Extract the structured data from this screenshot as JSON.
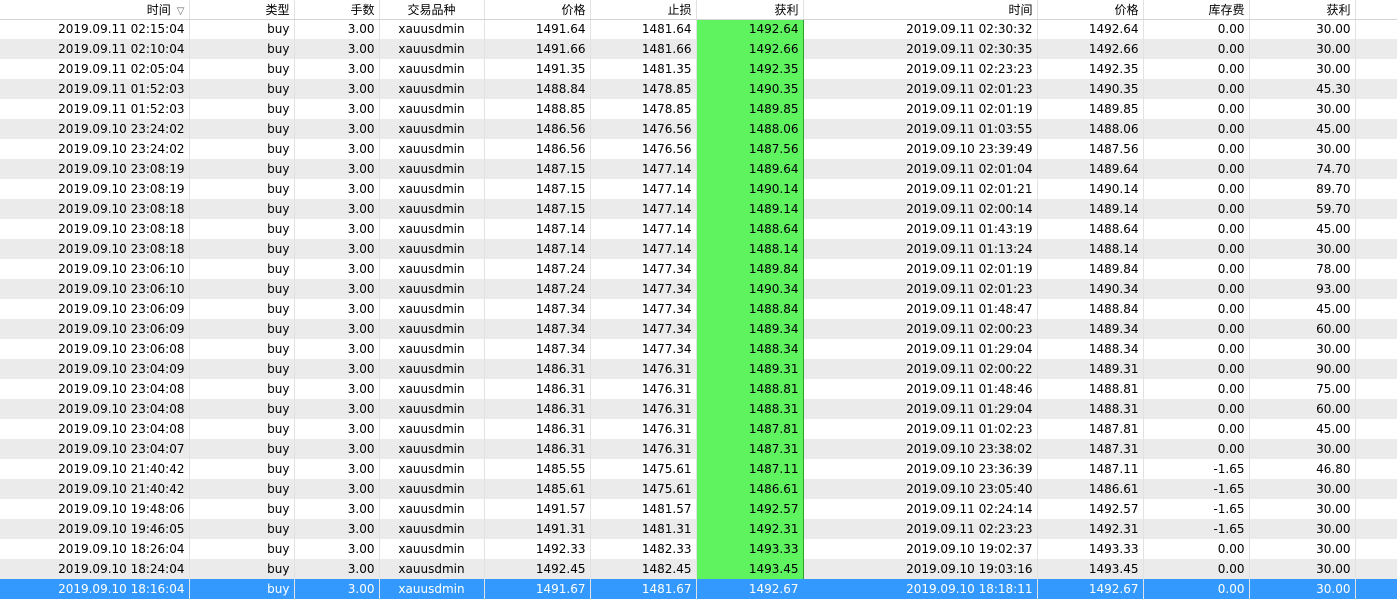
{
  "headers": {
    "open_time": "时间",
    "sort_icon": "▽",
    "type": "类型",
    "lots": "手数",
    "symbol": "交易品种",
    "price": "价格",
    "sl": "止损",
    "tp": "获利",
    "empty": "",
    "close_time": "时间",
    "close_price": "价格",
    "swap": "库存费",
    "profit": "获利"
  },
  "rows": [
    [
      "2019.09.11 02:15:04",
      "buy",
      "3.00",
      "xauusdmin",
      "1491.64",
      "1481.64",
      "1492.64",
      "2019.09.11 02:30:32",
      "1492.64",
      "0.00",
      "30.00"
    ],
    [
      "2019.09.11 02:10:04",
      "buy",
      "3.00",
      "xauusdmin",
      "1491.66",
      "1481.66",
      "1492.66",
      "2019.09.11 02:30:35",
      "1492.66",
      "0.00",
      "30.00"
    ],
    [
      "2019.09.11 02:05:04",
      "buy",
      "3.00",
      "xauusdmin",
      "1491.35",
      "1481.35",
      "1492.35",
      "2019.09.11 02:23:23",
      "1492.35",
      "0.00",
      "30.00"
    ],
    [
      "2019.09.11 01:52:03",
      "buy",
      "3.00",
      "xauusdmin",
      "1488.84",
      "1478.85",
      "1490.35",
      "2019.09.11 02:01:23",
      "1490.35",
      "0.00",
      "45.30"
    ],
    [
      "2019.09.11 01:52:03",
      "buy",
      "3.00",
      "xauusdmin",
      "1488.85",
      "1478.85",
      "1489.85",
      "2019.09.11 02:01:19",
      "1489.85",
      "0.00",
      "30.00"
    ],
    [
      "2019.09.10 23:24:02",
      "buy",
      "3.00",
      "xauusdmin",
      "1486.56",
      "1476.56",
      "1488.06",
      "2019.09.11 01:03:55",
      "1488.06",
      "0.00",
      "45.00"
    ],
    [
      "2019.09.10 23:24:02",
      "buy",
      "3.00",
      "xauusdmin",
      "1486.56",
      "1476.56",
      "1487.56",
      "2019.09.10 23:39:49",
      "1487.56",
      "0.00",
      "30.00"
    ],
    [
      "2019.09.10 23:08:19",
      "buy",
      "3.00",
      "xauusdmin",
      "1487.15",
      "1477.14",
      "1489.64",
      "2019.09.11 02:01:04",
      "1489.64",
      "0.00",
      "74.70"
    ],
    [
      "2019.09.10 23:08:19",
      "buy",
      "3.00",
      "xauusdmin",
      "1487.15",
      "1477.14",
      "1490.14",
      "2019.09.11 02:01:21",
      "1490.14",
      "0.00",
      "89.70"
    ],
    [
      "2019.09.10 23:08:18",
      "buy",
      "3.00",
      "xauusdmin",
      "1487.15",
      "1477.14",
      "1489.14",
      "2019.09.11 02:00:14",
      "1489.14",
      "0.00",
      "59.70"
    ],
    [
      "2019.09.10 23:08:18",
      "buy",
      "3.00",
      "xauusdmin",
      "1487.14",
      "1477.14",
      "1488.64",
      "2019.09.11 01:43:19",
      "1488.64",
      "0.00",
      "45.00"
    ],
    [
      "2019.09.10 23:08:18",
      "buy",
      "3.00",
      "xauusdmin",
      "1487.14",
      "1477.14",
      "1488.14",
      "2019.09.11 01:13:24",
      "1488.14",
      "0.00",
      "30.00"
    ],
    [
      "2019.09.10 23:06:10",
      "buy",
      "3.00",
      "xauusdmin",
      "1487.24",
      "1477.34",
      "1489.84",
      "2019.09.11 02:01:19",
      "1489.84",
      "0.00",
      "78.00"
    ],
    [
      "2019.09.10 23:06:10",
      "buy",
      "3.00",
      "xauusdmin",
      "1487.24",
      "1477.34",
      "1490.34",
      "2019.09.11 02:01:23",
      "1490.34",
      "0.00",
      "93.00"
    ],
    [
      "2019.09.10 23:06:09",
      "buy",
      "3.00",
      "xauusdmin",
      "1487.34",
      "1477.34",
      "1488.84",
      "2019.09.11 01:48:47",
      "1488.84",
      "0.00",
      "45.00"
    ],
    [
      "2019.09.10 23:06:09",
      "buy",
      "3.00",
      "xauusdmin",
      "1487.34",
      "1477.34",
      "1489.34",
      "2019.09.11 02:00:23",
      "1489.34",
      "0.00",
      "60.00"
    ],
    [
      "2019.09.10 23:06:08",
      "buy",
      "3.00",
      "xauusdmin",
      "1487.34",
      "1477.34",
      "1488.34",
      "2019.09.11 01:29:04",
      "1488.34",
      "0.00",
      "30.00"
    ],
    [
      "2019.09.10 23:04:09",
      "buy",
      "3.00",
      "xauusdmin",
      "1486.31",
      "1476.31",
      "1489.31",
      "2019.09.11 02:00:22",
      "1489.31",
      "0.00",
      "90.00"
    ],
    [
      "2019.09.10 23:04:08",
      "buy",
      "3.00",
      "xauusdmin",
      "1486.31",
      "1476.31",
      "1488.81",
      "2019.09.11 01:48:46",
      "1488.81",
      "0.00",
      "75.00"
    ],
    [
      "2019.09.10 23:04:08",
      "buy",
      "3.00",
      "xauusdmin",
      "1486.31",
      "1476.31",
      "1488.31",
      "2019.09.11 01:29:04",
      "1488.31",
      "0.00",
      "60.00"
    ],
    [
      "2019.09.10 23:04:08",
      "buy",
      "3.00",
      "xauusdmin",
      "1486.31",
      "1476.31",
      "1487.81",
      "2019.09.11 01:02:23",
      "1487.81",
      "0.00",
      "45.00"
    ],
    [
      "2019.09.10 23:04:07",
      "buy",
      "3.00",
      "xauusdmin",
      "1486.31",
      "1476.31",
      "1487.31",
      "2019.09.10 23:38:02",
      "1487.31",
      "0.00",
      "30.00"
    ],
    [
      "2019.09.10 21:40:42",
      "buy",
      "3.00",
      "xauusdmin",
      "1485.55",
      "1475.61",
      "1487.11",
      "2019.09.10 23:36:39",
      "1487.11",
      "-1.65",
      "46.80"
    ],
    [
      "2019.09.10 21:40:42",
      "buy",
      "3.00",
      "xauusdmin",
      "1485.61",
      "1475.61",
      "1486.61",
      "2019.09.10 23:05:40",
      "1486.61",
      "-1.65",
      "30.00"
    ],
    [
      "2019.09.10 19:48:06",
      "buy",
      "3.00",
      "xauusdmin",
      "1491.57",
      "1481.57",
      "1492.57",
      "2019.09.11 02:24:14",
      "1492.57",
      "-1.65",
      "30.00"
    ],
    [
      "2019.09.10 19:46:05",
      "buy",
      "3.00",
      "xauusdmin",
      "1491.31",
      "1481.31",
      "1492.31",
      "2019.09.11 02:23:23",
      "1492.31",
      "-1.65",
      "30.00"
    ],
    [
      "2019.09.10 18:26:04",
      "buy",
      "3.00",
      "xauusdmin",
      "1492.33",
      "1482.33",
      "1493.33",
      "2019.09.10 19:02:37",
      "1493.33",
      "0.00",
      "30.00"
    ],
    [
      "2019.09.10 18:24:04",
      "buy",
      "3.00",
      "xauusdmin",
      "1492.45",
      "1482.45",
      "1493.45",
      "2019.09.10 19:03:16",
      "1493.45",
      "0.00",
      "30.00"
    ],
    [
      "2019.09.10 18:16:04",
      "buy",
      "3.00",
      "xauusdmin",
      "1491.67",
      "1481.67",
      "1492.67",
      "2019.09.10 18:18:11",
      "1492.67",
      "0.00",
      "30.00"
    ]
  ],
  "selected_row": 28,
  "colors": {
    "tp_highlight": "#5ff35f",
    "selection": "#3399ff",
    "alt_row": "#ebebeb"
  }
}
